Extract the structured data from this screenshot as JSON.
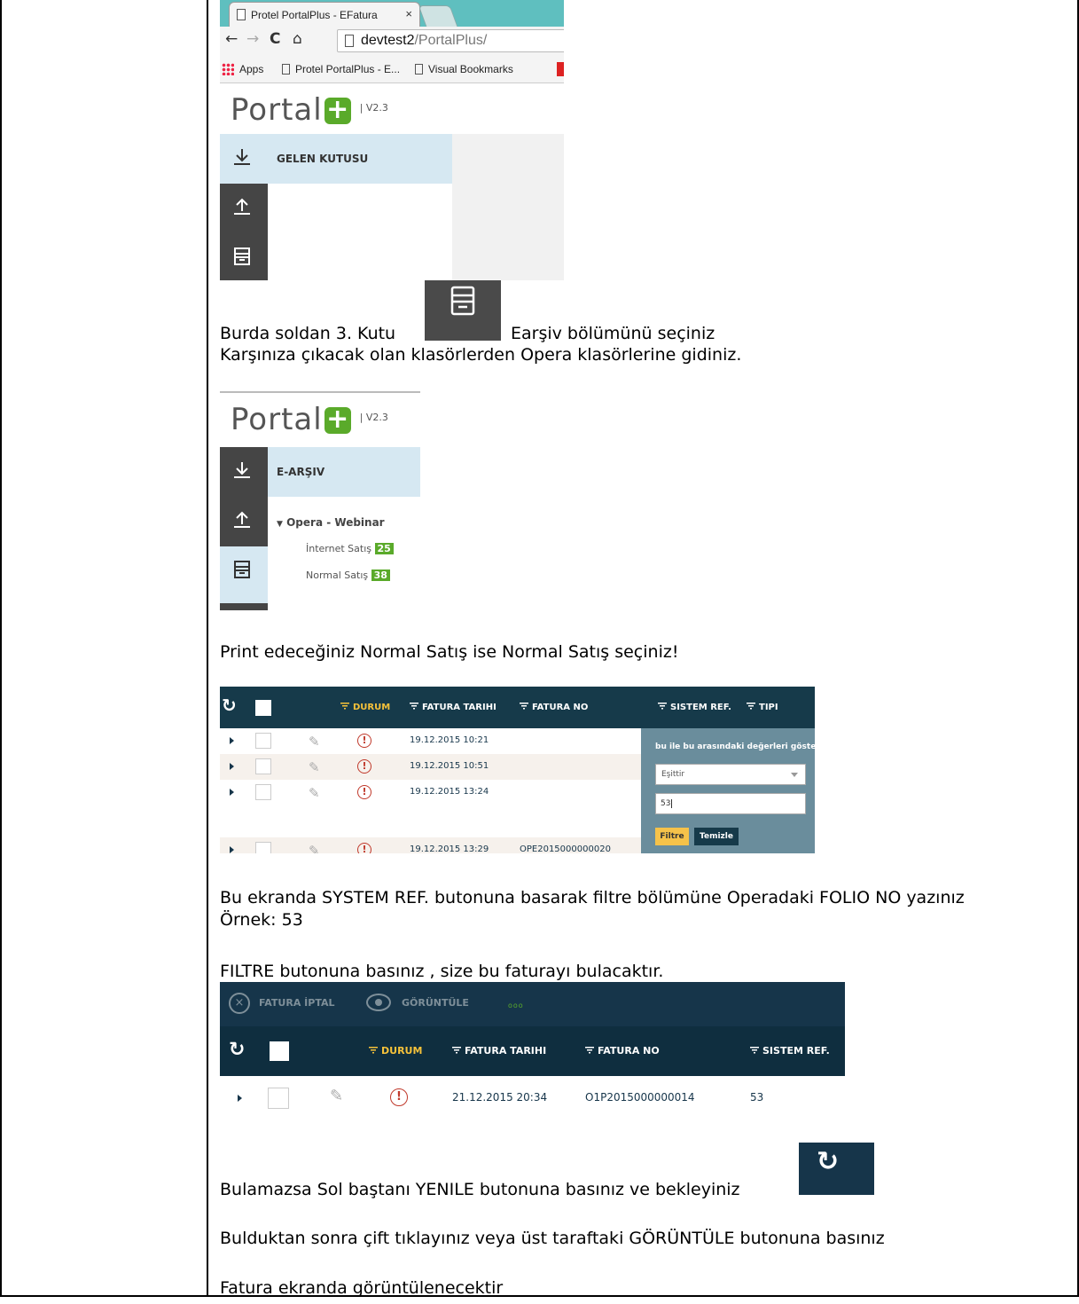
{
  "browser": {
    "tab_title": "Protel PortalPlus - EFatura",
    "tab_close": "×",
    "url_host": "devtest2",
    "url_path": "/PortalPlus/",
    "bookmarks": [
      "Apps",
      "Protel PortalPlus - E...",
      "Visual Bookmarks"
    ]
  },
  "portal": {
    "logo_text": "Portal",
    "logo_plus": "+",
    "version": "| V2.3",
    "inbox_label": "GELEN KUTUSU",
    "earsiv_label": "E-ARŞIV",
    "tree_root": "Opera - Webinar",
    "tree_items": [
      {
        "label": "İnternet Satış",
        "count": "25"
      },
      {
        "label": "Normal Satış",
        "count": "38"
      }
    ]
  },
  "doc": {
    "line1_a": "Burda soldan 3. Kutu",
    "line1_b": "Earşiv bölümünü seçiniz",
    "line2": "Karşınıza çıkacak olan klasörlerden Opera klasörlerine gidiniz.",
    "line3": "Print edeceğiniz Normal Satış ise Normal Satış seçiniz!",
    "line4": "Bu ekranda SYSTEM REF.  butonuna basarak filtre bölümüne Operadaki FOLIO NO yazınız",
    "line5": "Örnek: 53",
    "line6": "FILTRE butonuna basınız , size bu faturayı bulacaktır.",
    "line7": "Bulamazsa Sol baştanı YENILE butonuna basınız ve bekleyiniz",
    "line8": "Bulduktan sonra çift tıklayınız veya üst taraftaki GÖRÜNTÜLE butonuna basınız",
    "line9": "Fatura ekranda görüntülenecektir"
  },
  "grid1": {
    "headers": [
      "DURUM",
      "FATURA TARIHI",
      "FATURA NO",
      "SISTEM REF.",
      "TIPI"
    ],
    "rows": [
      {
        "date": "19.12.2015 10:21",
        "no": ""
      },
      {
        "date": "19.12.2015 10:51",
        "no": ""
      },
      {
        "date": "19.12.2015 13:24",
        "no": ""
      },
      {
        "date": "19.12.2015 13:29",
        "no": "OPE2015000000020"
      }
    ],
    "filter": {
      "title": "bu ile bu arasındaki değerleri göster",
      "select_value": "Eşittir",
      "input_value": "53",
      "filter_btn": "Filtre",
      "clear_btn": "Temizle"
    }
  },
  "grid2": {
    "toolbar": [
      "FATURA İPTAL",
      "GÖRÜNTÜLE"
    ],
    "more": "ooo",
    "headers": [
      "DURUM",
      "FATURA TARIHI",
      "FATURA NO",
      "SISTEM REF."
    ],
    "row": {
      "date": "21.12.2015 20:34",
      "no": "O1P2015000000014",
      "ref": "53"
    }
  },
  "colors": {
    "navy": "#16354a",
    "accent_yellow": "#f6c23a",
    "portal_green": "#5aaa2a",
    "sidebar": "#454545",
    "menu_active": "#d6e8f2"
  }
}
